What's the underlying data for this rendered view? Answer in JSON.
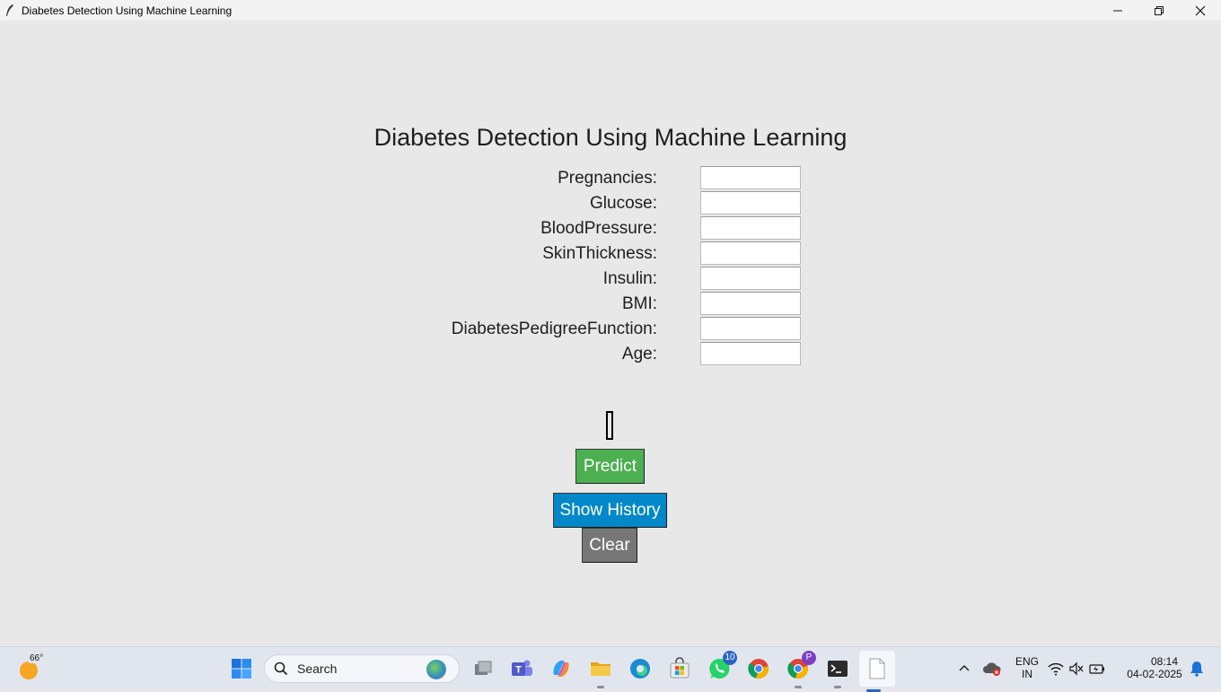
{
  "window": {
    "title": "Diabetes Detection Using Machine Learning",
    "controls": [
      "minimize-icon",
      "restore-icon",
      "close-icon"
    ]
  },
  "app": {
    "heading": "Diabetes Detection Using Machine Learning",
    "fields": [
      {
        "label": "Pregnancies:",
        "value": ""
      },
      {
        "label": "Glucose:",
        "value": ""
      },
      {
        "label": "BloodPressure:",
        "value": ""
      },
      {
        "label": "SkinThickness:",
        "value": ""
      },
      {
        "label": "Insulin:",
        "value": ""
      },
      {
        "label": "BMI:",
        "value": ""
      },
      {
        "label": "DiabetesPedigreeFunction:",
        "value": ""
      },
      {
        "label": "Age:",
        "value": ""
      }
    ],
    "result_text": "",
    "buttons": {
      "predict": "Predict",
      "history": "Show History",
      "clear": "Clear"
    },
    "colors": {
      "predict": "#4caf50",
      "history": "#0288c8",
      "clear": "#777777",
      "background": "#e8e8e8"
    }
  },
  "taskbar": {
    "weather_temp": "66°",
    "search_placeholder": "Search",
    "whatsapp_badge": "10",
    "chrome_profile_badge": "P",
    "language": "ENG",
    "region": "IN",
    "time": "08:14",
    "date": "04-02-2025"
  }
}
